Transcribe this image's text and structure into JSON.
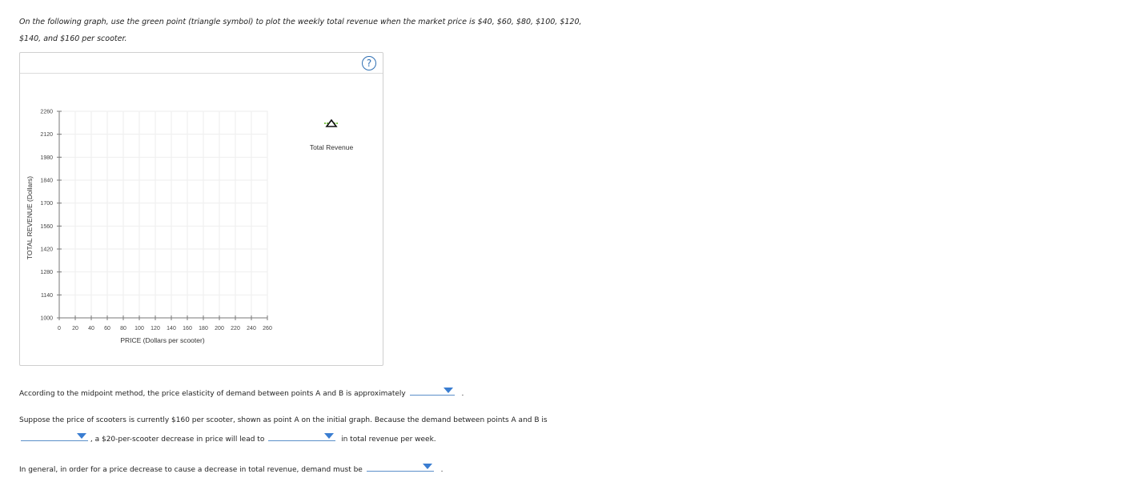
{
  "instructions": {
    "line1": "On the following graph, use the green point (triangle symbol) to plot the weekly total revenue when the market price is $40, $60, $80, $100, $120,",
    "line2": "$140, and $160 per scooter."
  },
  "help_label": "?",
  "chart_data": {
    "type": "scatter",
    "xlabel": "PRICE (Dollars per scooter)",
    "ylabel": "TOTAL REVENUE (Dollars)",
    "xlim": [
      0,
      260
    ],
    "ylim": [
      1000,
      2260
    ],
    "x_ticks": [
      "0",
      "20",
      "40",
      "60",
      "80",
      "100",
      "120",
      "140",
      "160",
      "180",
      "200",
      "220",
      "240",
      "260"
    ],
    "y_ticks": [
      "2260",
      "2120",
      "1980",
      "1840",
      "1700",
      "1560",
      "1420",
      "1280",
      "1140",
      "1000"
    ],
    "grid": true,
    "series": [
      {
        "name": "Total Revenue",
        "marker": "triangle",
        "color": "#7dc44a",
        "points": []
      }
    ],
    "legend_placement": "right"
  },
  "q1": {
    "text": "According to the midpoint method, the price elasticity of demand between points A and B is approximately",
    "end": "."
  },
  "q2": {
    "line1": "Suppose the price of scooters is currently $160 per scooter, shown as point A on the initial graph. Because the demand between points A and B is",
    "mid": ", a $20-per-scooter decrease in price will lead to",
    "end": "in total revenue per week."
  },
  "q3": {
    "text": "In general, in order for a price decrease to cause a decrease in total revenue, demand must be",
    "end": "."
  },
  "colors": {
    "accent": "#3a7dd1",
    "marker_green": "#7dc44a"
  }
}
